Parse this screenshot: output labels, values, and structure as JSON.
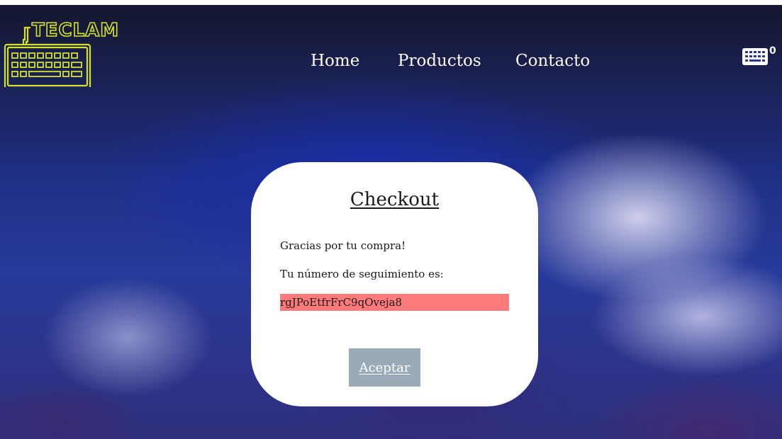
{
  "brand": {
    "logo_text": "TECLAM",
    "logo_color": "#d4e02a"
  },
  "nav": {
    "items": [
      {
        "label": "Home"
      },
      {
        "label": "Productos"
      },
      {
        "label": "Contacto"
      }
    ]
  },
  "cart": {
    "icon": "keyboard-icon",
    "count": "0"
  },
  "checkout": {
    "title": "Checkout",
    "thanks_text": "Gracias por tu compra!",
    "tracking_label": "Tu número de seguimiento es:",
    "tracking_number": "rgJPoEtfrFrC9qOveja8",
    "tracking_highlight": "#ff7a7a",
    "accept_label": "Aceptar",
    "accept_color": "#9aaab8"
  }
}
